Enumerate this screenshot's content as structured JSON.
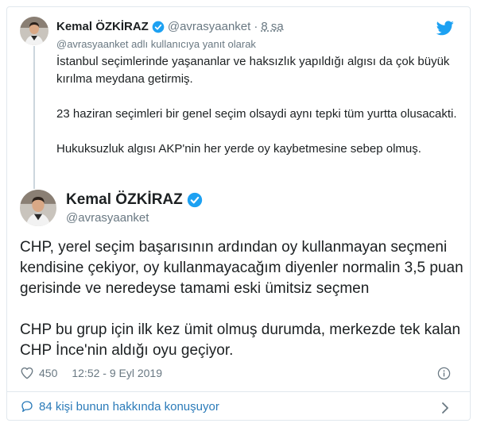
{
  "parent_tweet": {
    "author_name": "Kemal ÖZKİRAZ",
    "handle": "@avrasyaanket",
    "separator": "·",
    "time": "8 sa",
    "reply_context": "@avrasyaanket adlı kullanıcıya yanıt olarak",
    "paragraphs": [
      "İstanbul seçimlerinde yaşananlar ve haksızlık yapıldığı algısı da çok büyük kırılma meydana getirmiş.",
      "23 haziran seçimleri bir genel seçim olsaydi aynı tepki tüm yurtta olusacakti.",
      "Hukuksuzluk algısı AKP'nin her yerde oy kaybetmesine sebep olmuş."
    ]
  },
  "main_tweet": {
    "author_name": "Kemal ÖZKİRAZ",
    "handle": "@avrasyaanket",
    "paragraphs": [
      "CHP, yerel seçim başarısının ardından oy kullanmayan seçmeni kendisine çekiyor, oy kullanmayacağım diyenler normalin 3,5 puan gerisinde ve neredeyse tamami eski ümitsiz seçmen",
      "CHP bu grup için ilk kez ümit olmuş durumda, merkezde tek kalan CHP İnce'nin aldığı oyu geçiyor."
    ],
    "like_count": "450",
    "timestamp": "12:52 - 9 Eyl 2019",
    "conversation_label": "84 kişi bunun hakkında konuşuyor"
  },
  "icons": {
    "verified": "verified-badge-icon",
    "twitter": "twitter-bird-icon",
    "like": "heart-icon",
    "info": "info-icon",
    "conversation": "speech-bubble-icon",
    "more": "chevron-right-icon"
  },
  "colors": {
    "text": "#1c2022",
    "secondary": "#697882",
    "link": "#2b7bb9",
    "verified": "#1da1f2",
    "twitter": "#1da1f2",
    "border": "#e1e8ed"
  }
}
